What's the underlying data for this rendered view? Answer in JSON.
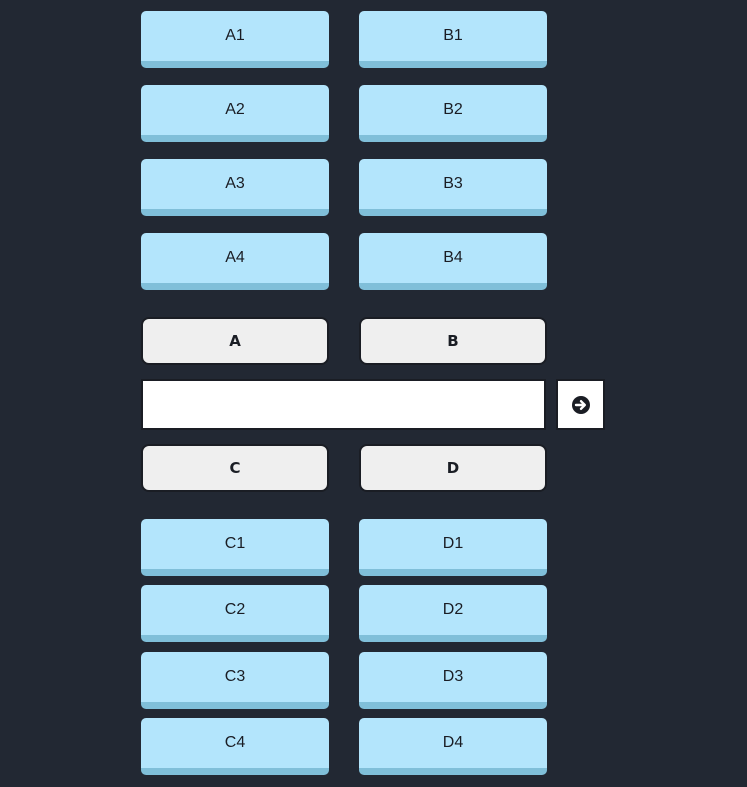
{
  "top_keys": {
    "a": [
      "A1",
      "A2",
      "A3",
      "A4"
    ],
    "b": [
      "B1",
      "B2",
      "B3",
      "B4"
    ]
  },
  "group_buttons": {
    "a": "A",
    "b": "B",
    "c": "C",
    "d": "D"
  },
  "input": {
    "value": "",
    "placeholder": ""
  },
  "submit": {
    "icon": "arrow-right-circle-icon"
  },
  "bottom_keys": {
    "c": [
      "C1",
      "C2",
      "C3",
      "C4"
    ],
    "d": [
      "D1",
      "D2",
      "D3",
      "D4"
    ]
  },
  "colors": {
    "background": "#222833",
    "key": "#b3e5fc",
    "key_shadow": "#80bfd9",
    "group_button": "#efefef",
    "border": "#1a1d24"
  }
}
